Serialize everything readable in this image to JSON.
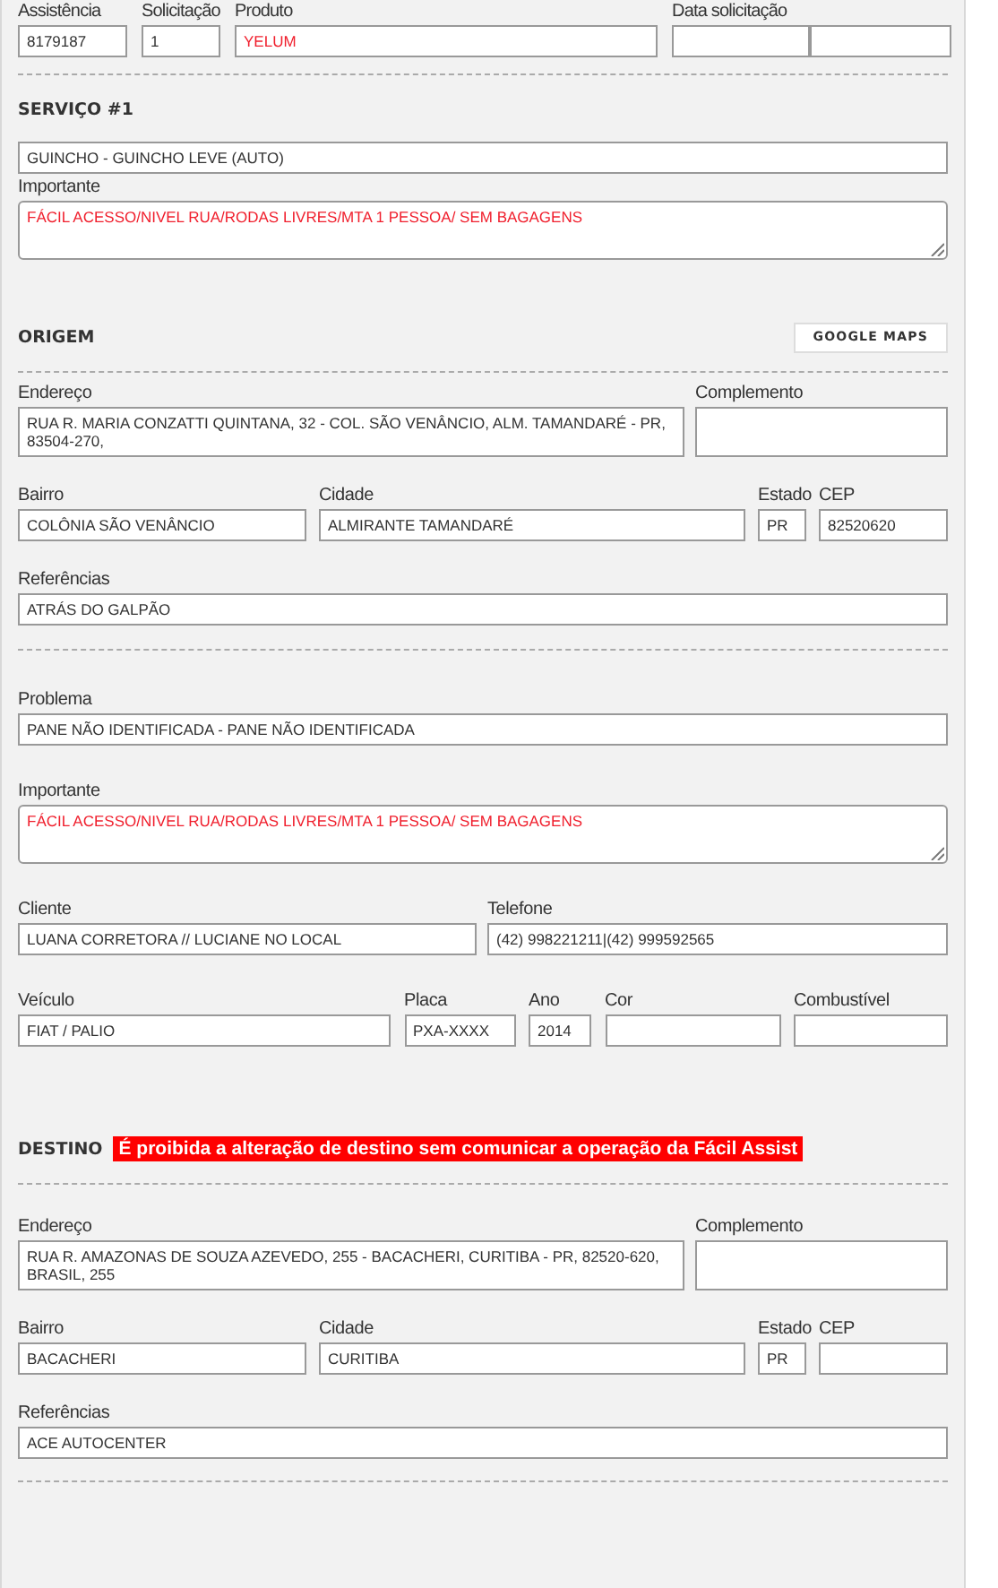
{
  "sections": [
    {
      "kind": "header",
      "rows": [
        {
          "kind": "header",
          "fields": [
            {
              "kind": "input",
              "label": "Assistência",
              "value": "8179187",
              "alert": false
            },
            {
              "kind": "input",
              "label": "Solicitação",
              "value": "1",
              "alert": false
            },
            {
              "kind": "input",
              "label": "Produto",
              "value": "YELUM",
              "alert": true
            },
            {
              "kind": "input",
              "label": "Data solicitação"
            },
            {
              "kind": "input"
            }
          ]
        }
      ]
    },
    {
      "kind": "service",
      "title": "SERVIÇO #1",
      "rows": [
        {
          "kind": "single",
          "fields": [
            {
              "kind": "input",
              "value": "GUINCHO - GUINCHO LEVE (AUTO)",
              "alert": false
            }
          ]
        },
        {
          "kind": "note",
          "fields": [
            {
              "kind": "textarea",
              "label": "Importante",
              "value": "FÁCIL ACESSO/NIVEL RUA/RODAS LIVRES/MTA 1 PESSOA/ SEM BAGAGENS",
              "alert": true
            }
          ]
        }
      ]
    },
    {
      "kind": "origin",
      "title": "ORIGEM",
      "button": "GOOGLE MAPS",
      "rows": [
        {
          "kind": "address",
          "fields": [
            {
              "kind": "input",
              "label": "Endereço",
              "value": "RUA R. MARIA CONZATTI QUINTANA, 32 - COL. SÃO VENÂNCIO, ALM. TAMANDARÉ - PR, 83504-270,",
              "alert": false
            },
            {
              "kind": "input",
              "label": "Complemento"
            }
          ]
        },
        {
          "kind": "locality",
          "fields": [
            {
              "kind": "input",
              "label": "Bairro",
              "value": "COLÔNIA SÃO VENÂNCIO",
              "alert": false
            },
            {
              "kind": "input",
              "label": "Cidade",
              "value": "ALMIRANTE TAMANDARÉ",
              "alert": false
            },
            {
              "kind": "input",
              "label": "Estado",
              "value": "PR",
              "alert": false
            },
            {
              "kind": "input",
              "label": "CEP",
              "value": "82520620",
              "alert": false
            }
          ]
        },
        {
          "kind": "single",
          "fields": [
            {
              "kind": "input",
              "label": "Referências",
              "value": "ATRÁS DO GALPÃO",
              "alert": false
            }
          ]
        }
      ]
    },
    {
      "kind": "details",
      "rows": [
        {
          "kind": "single",
          "fields": [
            {
              "kind": "input",
              "label": "Problema",
              "value": "PANE NÃO IDENTIFICADA - PANE NÃO IDENTIFICADA",
              "alert": false
            }
          ]
        },
        {
          "kind": "note",
          "fields": [
            {
              "kind": "textarea",
              "label": "Importante",
              "value": "FÁCIL ACESSO/NIVEL RUA/RODAS LIVRES/MTA 1 PESSOA/ SEM BAGAGENS",
              "alert": true
            }
          ]
        },
        {
          "kind": "contact",
          "fields": [
            {
              "kind": "input",
              "label": "Cliente",
              "value": "LUANA CORRETORA // LUCIANE NO LOCAL",
              "alert": false
            },
            {
              "kind": "input",
              "label": "Telefone",
              "value": "(42) 998221211|(42) 999592565",
              "alert": false
            }
          ]
        },
        {
          "kind": "vehicle",
          "fields": [
            {
              "kind": "input",
              "label": "Veículo",
              "value": "FIAT / PALIO",
              "alert": false
            },
            {
              "kind": "input",
              "label": "Placa",
              "value": "PXA-XXXX",
              "alert": false
            },
            {
              "kind": "input",
              "label": "Ano",
              "value": "2014",
              "alert": false
            },
            {
              "kind": "input",
              "label": "Cor"
            },
            {
              "kind": "input",
              "label": "Combustível"
            }
          ]
        }
      ]
    },
    {
      "kind": "destination",
      "title": "DESTINO",
      "warning": "É proibida a alteração de destino sem comunicar a operação da Fácil Assist",
      "rows": [
        {
          "kind": "address",
          "fields": [
            {
              "kind": "input",
              "label": "Endereço",
              "value": "RUA R. AMAZONAS DE SOUZA AZEVEDO, 255 - BACACHERI, CURITIBA - PR, 82520-620, BRASIL, 255",
              "alert": false
            },
            {
              "kind": "input",
              "label": "Complemento"
            }
          ]
        },
        {
          "kind": "locality",
          "fields": [
            {
              "kind": "input",
              "label": "Bairro",
              "value": "BACACHERI",
              "alert": false
            },
            {
              "kind": "input",
              "label": "Cidade",
              "value": "CURITIBA",
              "alert": false
            },
            {
              "kind": "input",
              "label": "Estado",
              "value": "PR",
              "alert": false
            },
            {
              "kind": "input",
              "label": "CEP"
            }
          ]
        },
        {
          "kind": "single",
          "fields": [
            {
              "kind": "input",
              "label": "Referências",
              "value": "ACE AUTOCENTER",
              "alert": false
            }
          ]
        }
      ]
    }
  ]
}
